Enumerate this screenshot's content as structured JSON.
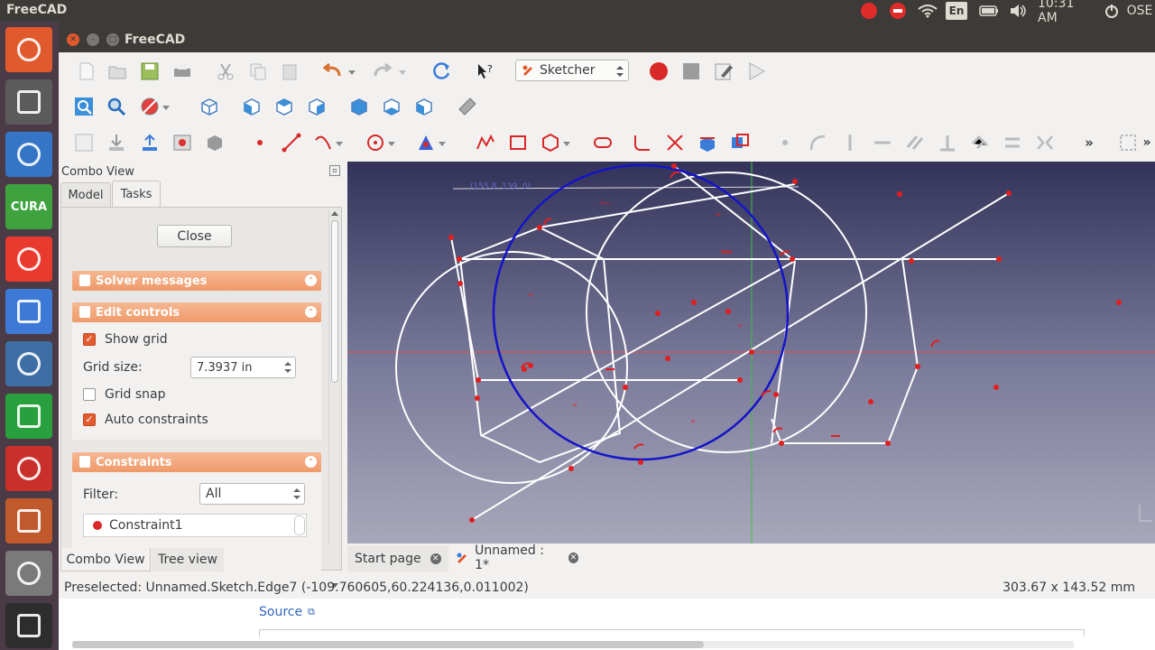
{
  "topbar": {
    "app_name": "FreeCAD",
    "keyboard": "En",
    "clock": "10:31 AM",
    "session": "OSE"
  },
  "launcher": [
    {
      "name": "ubuntu-dash-icon",
      "label": "",
      "color": "#e05a2d"
    },
    {
      "name": "calculator-icon",
      "label": "",
      "color": "#5b5b5b"
    },
    {
      "name": "freecad-launcher-icon",
      "label": "",
      "color": "#3475c6"
    },
    {
      "name": "cura-icon",
      "label": "CURA",
      "color": "#3ea33f"
    },
    {
      "name": "settings-blue-icon",
      "label": "",
      "color": "#e83a2d"
    },
    {
      "name": "chromium-icon",
      "label": "",
      "color": "#3d79d6"
    },
    {
      "name": "video-camera-icon",
      "label": "",
      "color": "#3d6fa5"
    },
    {
      "name": "spreadsheet-icon",
      "label": "",
      "color": "#27a03d"
    },
    {
      "name": "system-settings-icon",
      "label": "",
      "color": "#c9302c"
    },
    {
      "name": "files-icon",
      "label": "",
      "color": "#c05a2c"
    },
    {
      "name": "screenshot-icon",
      "label": "",
      "color": "#7a7a7a"
    },
    {
      "name": "terminal-icon",
      "label": "",
      "color": "#2d2d2d"
    }
  ],
  "window": {
    "title": "FreeCAD"
  },
  "toolbar": {
    "workbench": "Sketcher"
  },
  "combo": {
    "title": "Combo View",
    "tabs": [
      "Model",
      "Tasks"
    ],
    "close_label": "Close",
    "solver_title": "Solver messages",
    "edit_title": "Edit controls",
    "show_grid": "Show grid",
    "grid_size_label": "Grid size:",
    "grid_size_value": "7.3937 in",
    "grid_snap": "Grid snap",
    "auto_constraints": "Auto constraints",
    "constraints_title": "Constraints",
    "filter_label": "Filter:",
    "filter_value": "All",
    "constraint_item": "Constraint1",
    "bottom_tabs": [
      "Combo View",
      "Tree view"
    ]
  },
  "viewport": {
    "tooltip": "(155.8, 139, 0)"
  },
  "doc_tabs": [
    "Start page",
    "Unnamed : 1*"
  ],
  "status": {
    "preselected": "Preselected: Unnamed.Sketch.Edge7 (-109.760605,60.224136,0.011002)",
    "dimensions": "303.67 x 143.52 mm"
  },
  "background": {
    "source_link": "Source"
  },
  "colors": {
    "accent": "#e25b2d",
    "section": "#ef9a6a",
    "sketch_line": "#ffffff",
    "construction": "#1414c8",
    "constraint": "#e02020"
  }
}
